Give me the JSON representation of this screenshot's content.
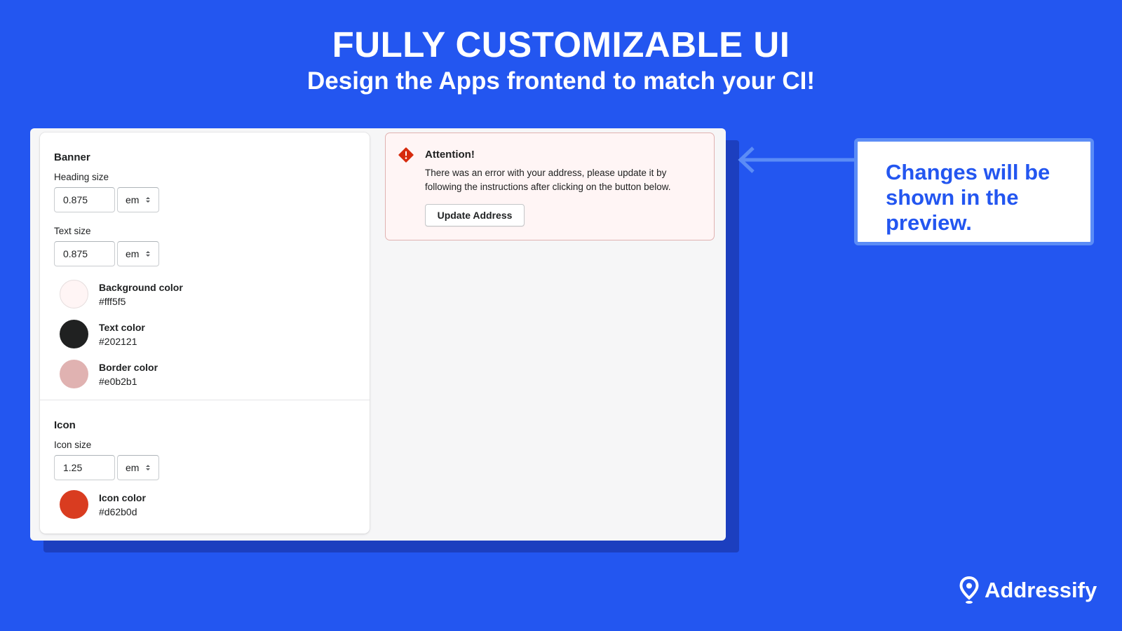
{
  "hero": {
    "title": "FULLY CUSTOMIZABLE UI",
    "subtitle": "Design the Apps frontend to match your CI!"
  },
  "settings": {
    "banner": {
      "title": "Banner",
      "heading_size": {
        "label": "Heading size",
        "value": "0.875",
        "unit": "em"
      },
      "text_size": {
        "label": "Text size",
        "value": "0.875",
        "unit": "em"
      },
      "colors": [
        {
          "name": "Background color",
          "hex": "#fff5f5"
        },
        {
          "name": "Text color",
          "hex": "#202121"
        },
        {
          "name": "Border color",
          "hex": "#e0b2b1"
        }
      ]
    },
    "icon": {
      "title": "Icon",
      "icon_size": {
        "label": "Icon size",
        "value": "1.25",
        "unit": "em"
      },
      "color": {
        "name": "Icon color",
        "hex": "#d62b0d"
      }
    }
  },
  "preview": {
    "heading": "Attention!",
    "text": "There was an error with your address, please update it by following the instructions after clicking on the button below.",
    "button_label": "Update Address",
    "icon": "alert-diamond-icon"
  },
  "callout": {
    "text": "Changes will be shown in the preview."
  },
  "brand": {
    "name": "Addressify",
    "icon": "map-pin-icon"
  },
  "colors": {
    "background": "#2356f0",
    "accent_light": "#5b8cf6",
    "banner_bg": "#fff5f5",
    "banner_border": "#e0b2b1",
    "banner_text": "#202121",
    "icon_color": "#d62b0d"
  }
}
